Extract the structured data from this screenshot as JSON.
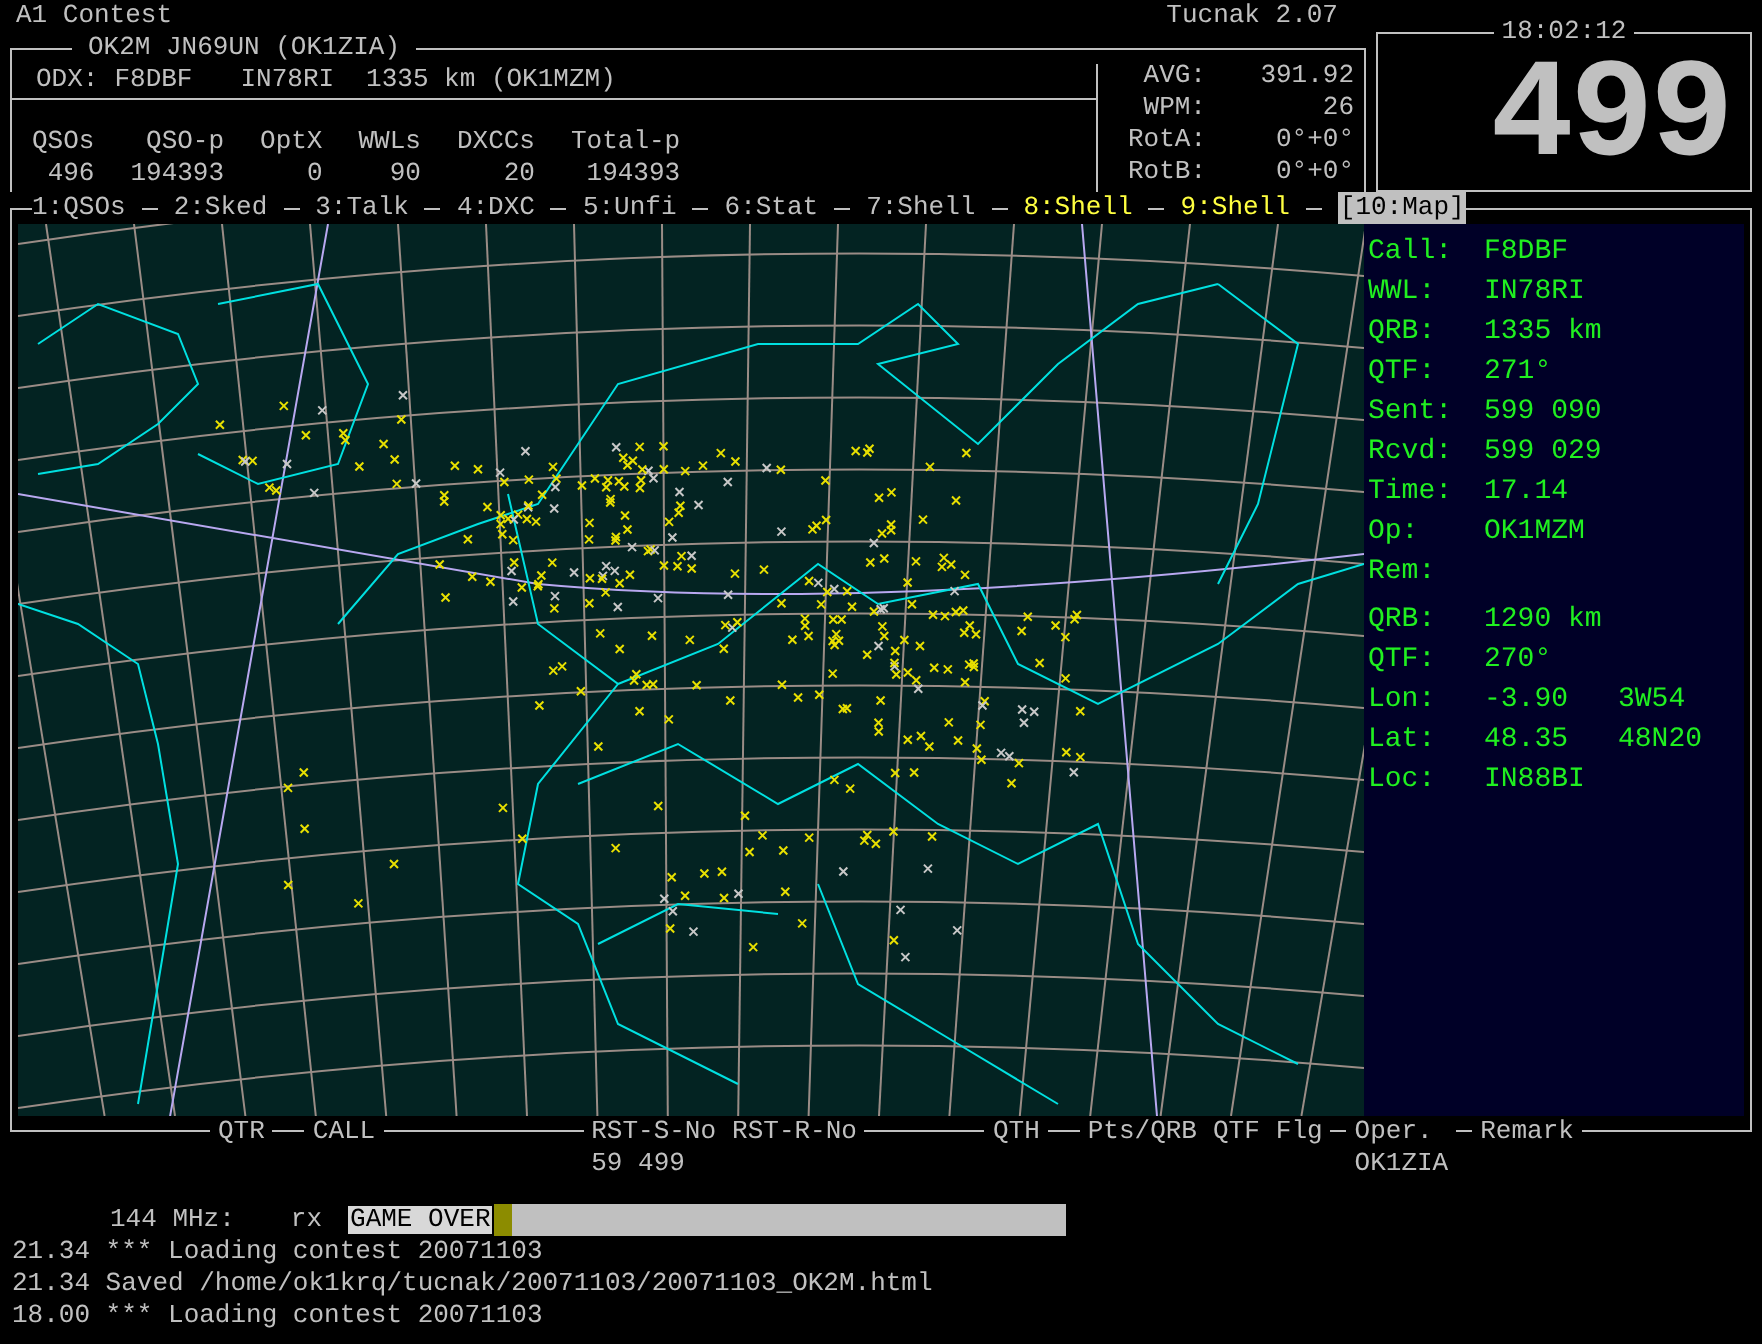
{
  "title": "A1 Contest",
  "app_version": "Tucnak 2.07",
  "station": {
    "title": "OK2M JN69UN (OK1ZIA)",
    "odx_label": "ODX:",
    "odx_call": "F8DBF",
    "odx_locator": "IN78RI",
    "odx_distance": "1335 km (OK1MZM)"
  },
  "stats": [
    {
      "label": "QSOs",
      "value": "496"
    },
    {
      "label": "QSO-p",
      "value": "194393"
    },
    {
      "label": "OptX",
      "value": "0"
    },
    {
      "label": "WWLs",
      "value": "90"
    },
    {
      "label": "DXCCs",
      "value": "20"
    },
    {
      "label": "Total-p",
      "value": "194393"
    }
  ],
  "rates": [
    {
      "label": "AVG:",
      "value": "391.92"
    },
    {
      "label": "WPM:",
      "value": "26"
    },
    {
      "label": "RotA:",
      "value": "0°+0°"
    },
    {
      "label": "RotB:",
      "value": "0°+0°"
    }
  ],
  "clock": {
    "time": "18:02:12",
    "report": "499"
  },
  "tabs": [
    {
      "label": "1:QSOs",
      "selected": false,
      "highlighted": false
    },
    {
      "label": "2:Sked",
      "selected": false,
      "highlighted": false
    },
    {
      "label": "3:Talk",
      "selected": false,
      "highlighted": false
    },
    {
      "label": "4:DXC",
      "selected": false,
      "highlighted": false
    },
    {
      "label": "5:Unfi",
      "selected": false,
      "highlighted": false
    },
    {
      "label": "6:Stat",
      "selected": false,
      "highlighted": false
    },
    {
      "label": "7:Shell",
      "selected": false,
      "highlighted": false
    },
    {
      "label": "8:Shell",
      "selected": false,
      "highlighted": true
    },
    {
      "label": "9:Shell",
      "selected": false,
      "highlighted": true
    },
    {
      "label": "[10:Map]",
      "selected": true,
      "highlighted": false
    }
  ],
  "qso_info": [
    {
      "label": "Call:",
      "value": "F8DBF"
    },
    {
      "label": "WWL:",
      "value": "IN78RI"
    },
    {
      "label": "QRB:",
      "value": "1335 km"
    },
    {
      "label": "QTF:",
      "value": "271°"
    },
    {
      "label": "Sent:",
      "value": "599 090"
    },
    {
      "label": "Rcvd:",
      "value": "599 029"
    },
    {
      "label": "Time:",
      "value": "17.14"
    },
    {
      "label": "Op:",
      "value": "OK1MZM"
    },
    {
      "label": "Rem:"
    }
  ],
  "cursor_info": [
    {
      "label": "QRB:",
      "value": "1290 km"
    },
    {
      "label": "QTF:",
      "value": "270°"
    },
    {
      "label": "Lon:",
      "value": "-3.90",
      "extra": "3W54"
    },
    {
      "label": "Lat:",
      "value": "48.35",
      "extra": "48N20"
    },
    {
      "label": "Loc:",
      "value": "IN88BI"
    }
  ],
  "log_columns": [
    {
      "label": "QTR"
    },
    {
      "label": "CALL"
    },
    {
      "label": "RST-S-No",
      "value": "59 499"
    },
    {
      "label": "RST-R-No"
    },
    {
      "label": "QTH"
    },
    {
      "label": "Pts/QRB"
    },
    {
      "label": "QTF"
    },
    {
      "label": "Flg"
    },
    {
      "label": "Oper.",
      "value": "OK1ZIA"
    },
    {
      "label": "Remark"
    }
  ],
  "band": {
    "label": "144 MHz:",
    "mode": "rx",
    "input": "GAME OVER"
  },
  "messages": [
    "21.34 *** Loading contest 20071103",
    "21.34 Saved /home/ok1krq/tucnak/20071103/20071103_OK2M.html",
    "18.00 *** Loading contest 20071103"
  ]
}
